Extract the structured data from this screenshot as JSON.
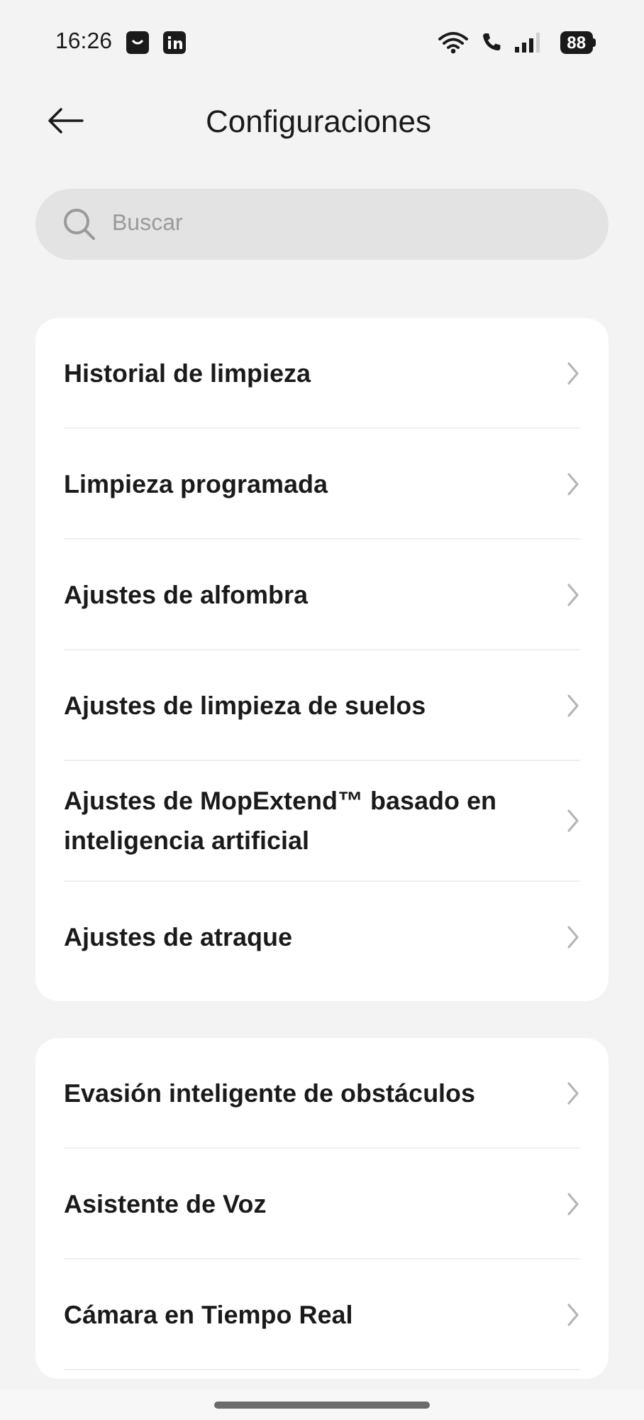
{
  "status_bar": {
    "time": "16:26",
    "battery": "88"
  },
  "header": {
    "title": "Configuraciones"
  },
  "search": {
    "placeholder": "Buscar"
  },
  "groups": [
    {
      "items": [
        {
          "label": "Historial de limpieza"
        },
        {
          "label": "Limpieza programada"
        },
        {
          "label": "Ajustes de alfombra"
        },
        {
          "label": "Ajustes de limpieza de suelos"
        },
        {
          "label": "Ajustes de MopExtend™ basado en inteligencia artificial"
        },
        {
          "label": "Ajustes de atraque"
        }
      ]
    },
    {
      "items": [
        {
          "label": "Evasión inteligente de obstáculos"
        },
        {
          "label": "Asistente de Voz"
        },
        {
          "label": "Cámara en Tiempo Real"
        }
      ]
    }
  ]
}
